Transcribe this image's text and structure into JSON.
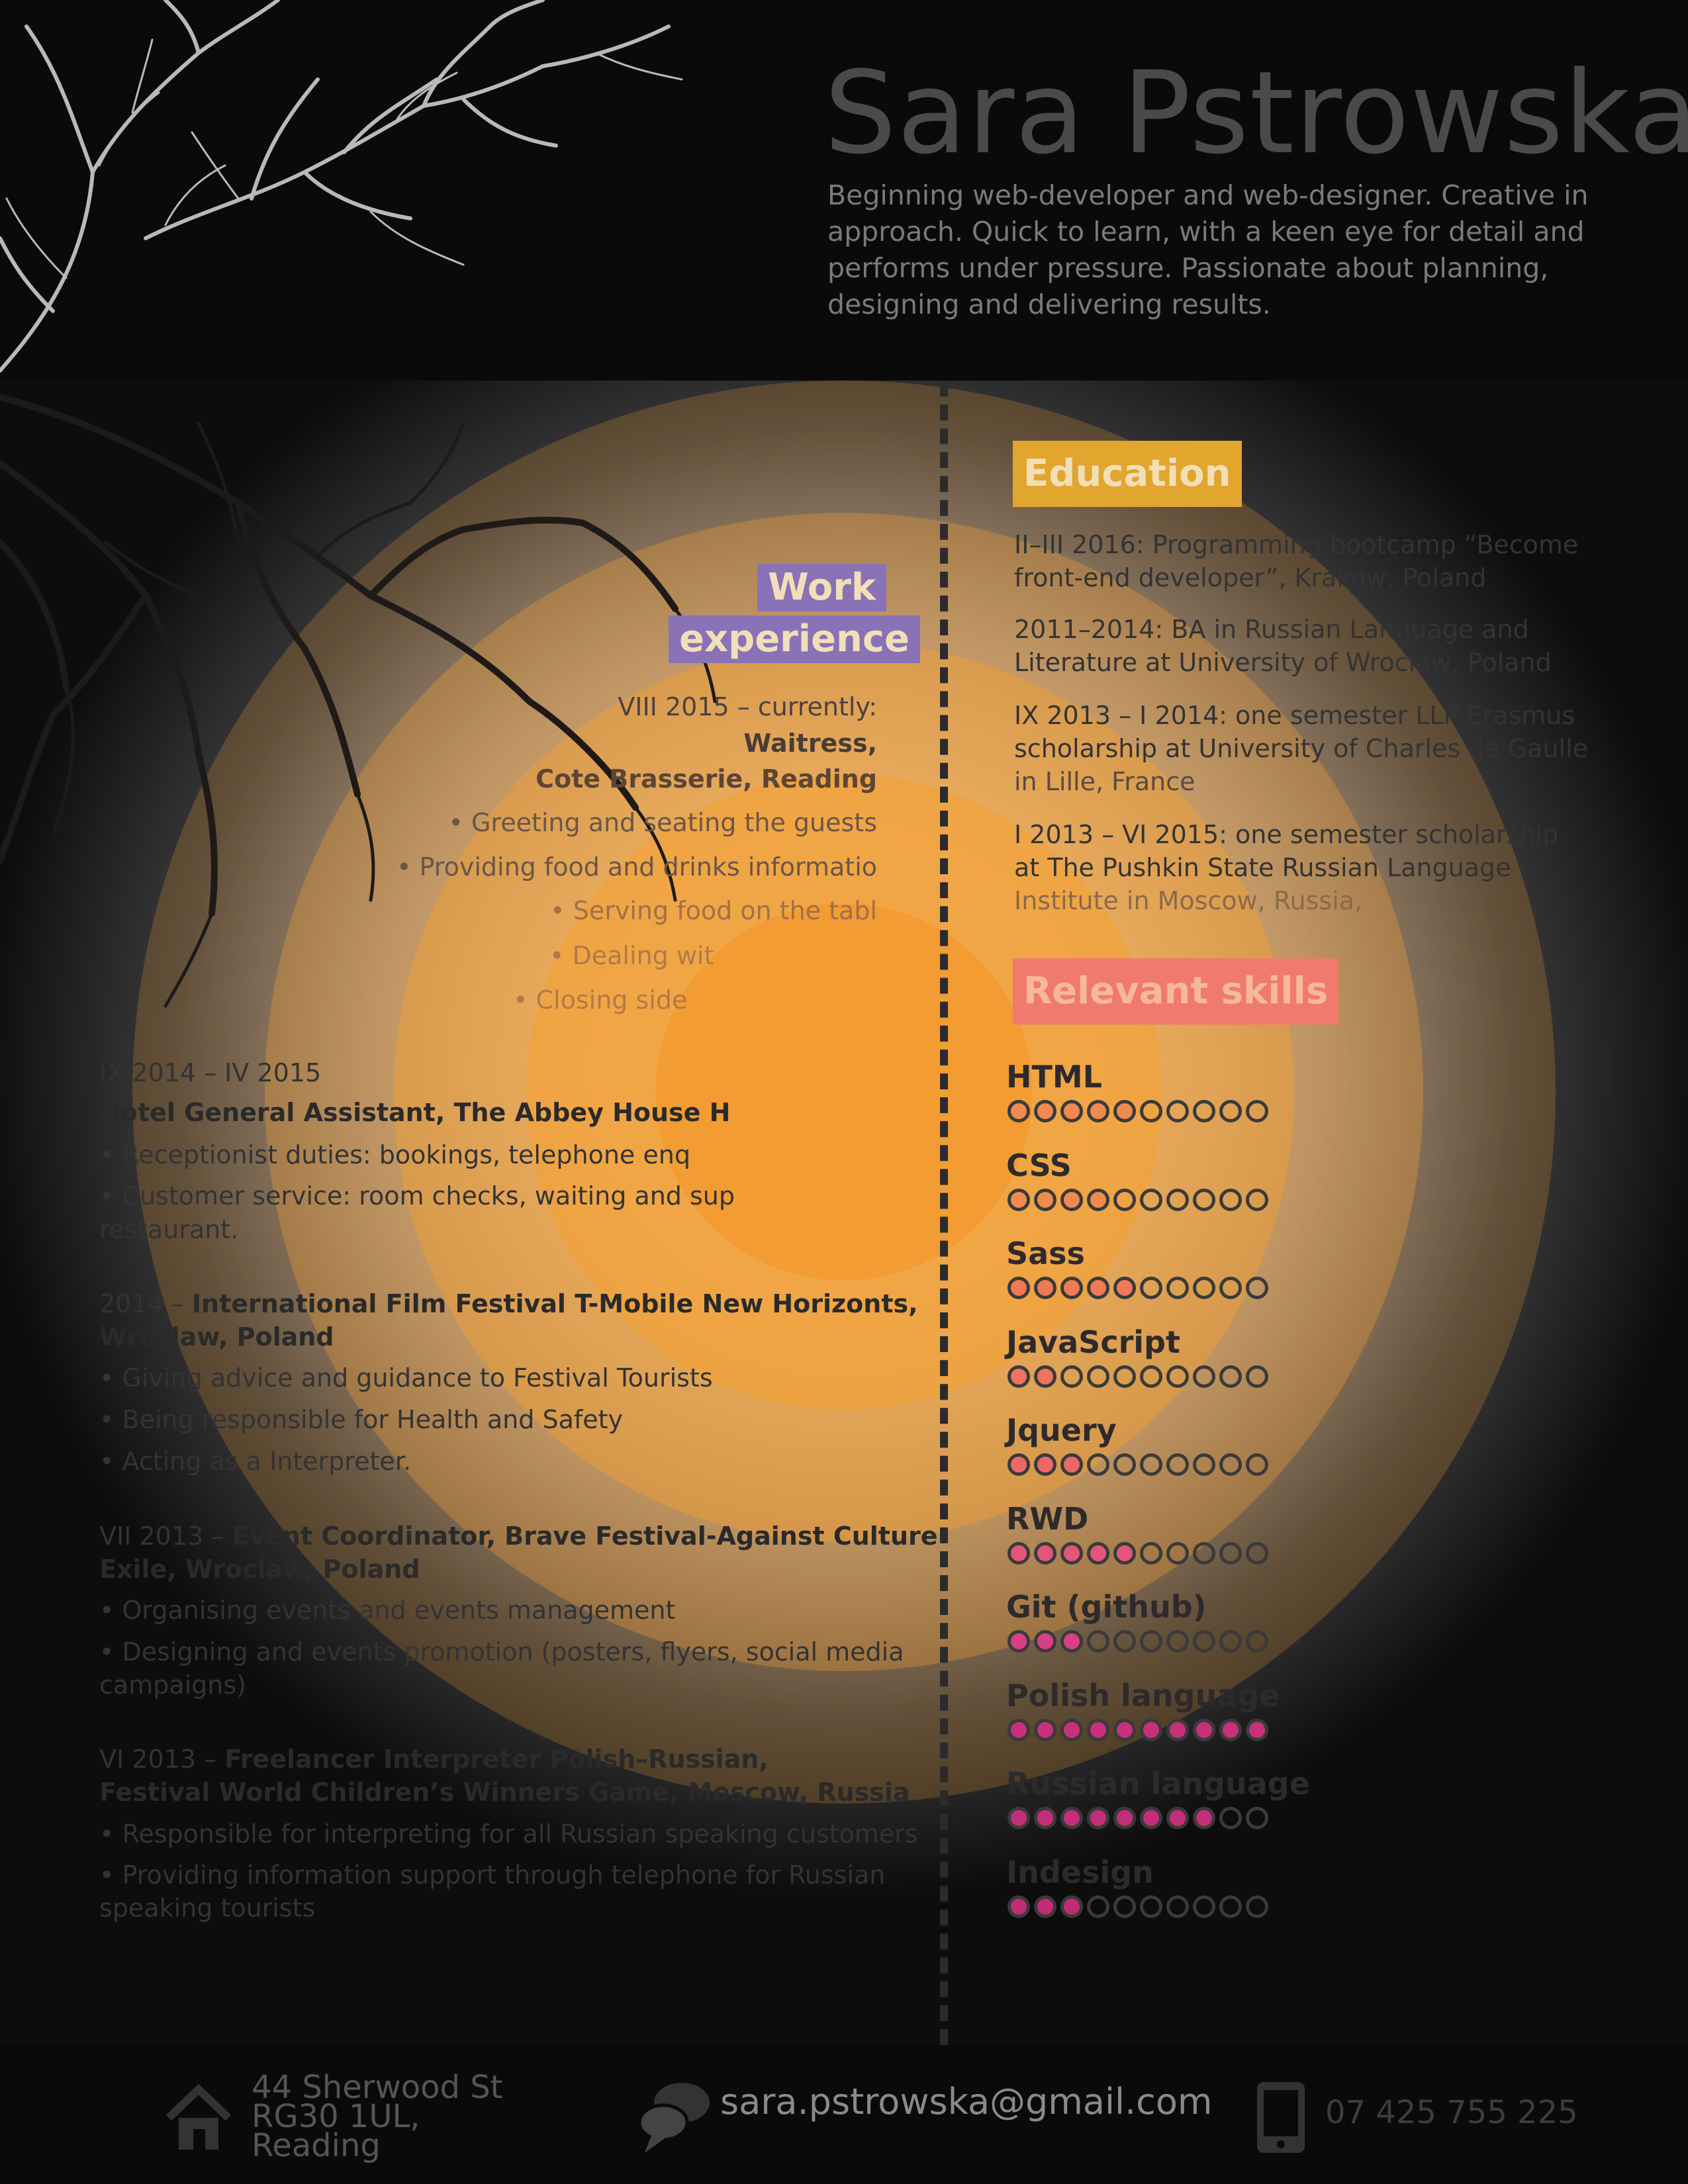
{
  "header": {
    "name": "Sara Pstrowska",
    "tagline": "Beginning web-developer and web-designer. Creative in approach. Quick to learn, with a keen eye for detail and performs under pressure. Passionate about planning, designing and delivering results."
  },
  "work": {
    "title_line1": "Work",
    "title_line2": "experience",
    "jobs": [
      {
        "date": "VIII 2015 – currently:",
        "role": "Waitress,",
        "place": "Cote Brasserie, Reading",
        "bullets": [
          "• Greeting and seating the guests",
          "• Providing food and drinks informatio",
          "• Serving food on the tabl",
          "• Dealing wit",
          "• Closing side"
        ]
      },
      {
        "date": "IX 2014 – IV 2015",
        "heading": "Hotel General Assistant, The Abbey House H",
        "bullets": [
          "• Receptionist duties: bookings, telephone enq",
          "• Customer service: room checks, waiting and sup",
          "restaurant."
        ]
      },
      {
        "date": "2014 – ",
        "heading_a": "International Film Festival T-Mobile New Horizonts,",
        "heading_b": "Wroclaw, Poland",
        "bullets": [
          "• Giving advice and guidance to Festival Tourists",
          "• Being responsible for Health and Safety",
          "• Acting as a Interpreter."
        ]
      },
      {
        "date": "VII 2013 – ",
        "heading_a": "Event Coordinator, Brave Festival-Against Culture",
        "heading_b": "Exile, Wroclaw, Poland",
        "bullets": [
          "• Organising events and events management",
          "• Designing and events promotion (posters, flyers, social media",
          "campaigns)"
        ]
      },
      {
        "date": "VI 2013 – ",
        "heading_a": "Freelancer Interpreter Polish–Russian,",
        "heading_b": "Festival World Children’s Winners Game, Moscow, Russia",
        "bullets": [
          "• Responsible for interpreting for all Russian speaking customers",
          "• Providing information support through telephone for Russian",
          "speaking tourists"
        ]
      }
    ]
  },
  "education": {
    "title": "Education",
    "items": [
      [
        "II–III 2016: Programming bootcamp “Become",
        "front-end developer”, Krakow, Poland"
      ],
      [
        "2011–2014: BA in Russian Language and",
        "Literature at University of Wroclaw, Poland"
      ],
      [
        "IX 2013 – I 2014: one semester LLP Erasmus",
        "scholarship at University of Charles de Gaulle",
        "in Lille, France"
      ],
      [
        "I 2013 – VI 2015: one semester scholarship",
        "at The Pushkin State Russian Language",
        "Institute in Moscow, Russia,"
      ]
    ]
  },
  "skills": {
    "title": "Relevant skills",
    "max": 10,
    "items": [
      {
        "name": "HTML",
        "level": 5,
        "color": "#f08a4e"
      },
      {
        "name": "CSS",
        "level": 4,
        "color": "#f08a4e"
      },
      {
        "name": "Sass",
        "level": 5,
        "color": "#f07a58"
      },
      {
        "name": "JavaScript",
        "level": 2,
        "color": "#ee7260"
      },
      {
        "name": "Jquery",
        "level": 3,
        "color": "#ec6868"
      },
      {
        "name": "RWD",
        "level": 5,
        "color": "#e2567a"
      },
      {
        "name": "Git (github)",
        "level": 3,
        "color": "#d84086"
      },
      {
        "name": "Polish language",
        "level": 10,
        "color": "#c8307a"
      },
      {
        "name": "Russian language",
        "level": 8,
        "color": "#c42e78"
      },
      {
        "name": "Indesign",
        "level": 3,
        "color": "#c02c76"
      }
    ]
  },
  "footer": {
    "address": [
      "44  Sherwood St",
      "RG30 1UL,",
      "Reading"
    ],
    "email": "sara.pstrowska@gmail.com",
    "phone": "07 425 755 225",
    "icons": [
      "home-icon",
      "speech-bubbles-icon",
      "phone-icon"
    ]
  },
  "colors": {
    "work_title_bg": "#8a72b6",
    "education_title_bg": "#e2a52e",
    "skills_title_bg": "#f07a6e",
    "ring": "#f5a031"
  }
}
